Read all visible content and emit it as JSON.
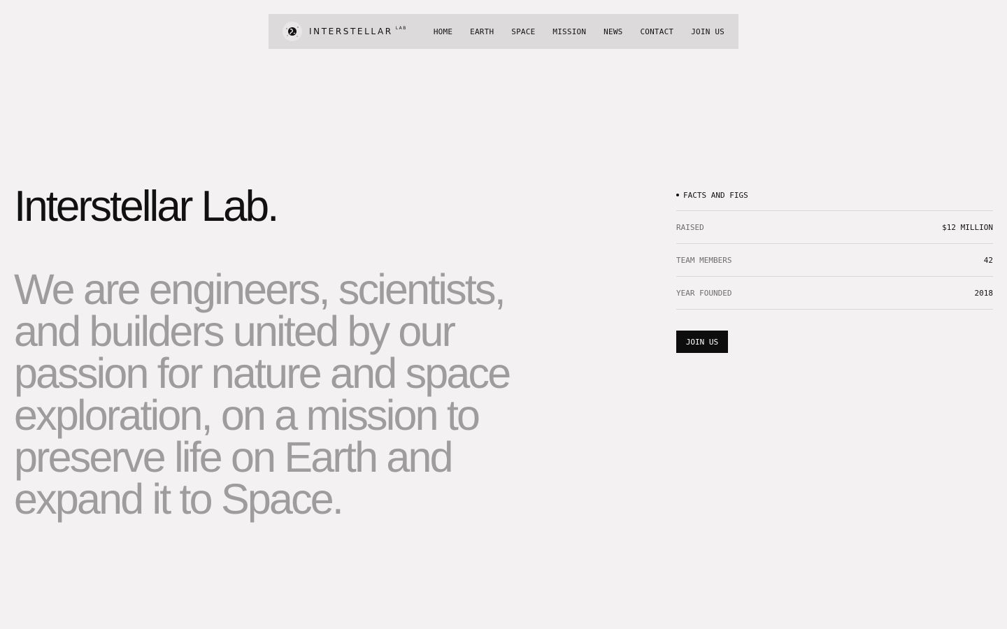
{
  "nav": {
    "brand_name": "INTERSTELLAR",
    "brand_sup": "LAB",
    "links": [
      "HOME",
      "EARTH",
      "SPACE",
      "MISSION",
      "NEWS",
      "CONTACT",
      "JOIN US"
    ]
  },
  "hero": {
    "title": "Interstellar Lab.",
    "copy": "We are engineers, scientists, and builders united by our passion for nature and space exploration, on a mission to preserve life on Earth and expand it to Space."
  },
  "facts": {
    "heading": "FACTS AND FIGS",
    "rows": [
      {
        "label": "RAISED",
        "value": "$12 MILLION"
      },
      {
        "label": "TEAM MEMBERS",
        "value": "42"
      },
      {
        "label": "YEAR FOUNDED",
        "value": "2018"
      }
    ],
    "cta_label": "JOIN US"
  },
  "colors": {
    "background": "#f3f1f2",
    "nav_background": "#dcdadb",
    "muted_text": "#9e9c9d",
    "button": "#0d0d0d"
  },
  "icons": {
    "logo": "globe-icon"
  }
}
